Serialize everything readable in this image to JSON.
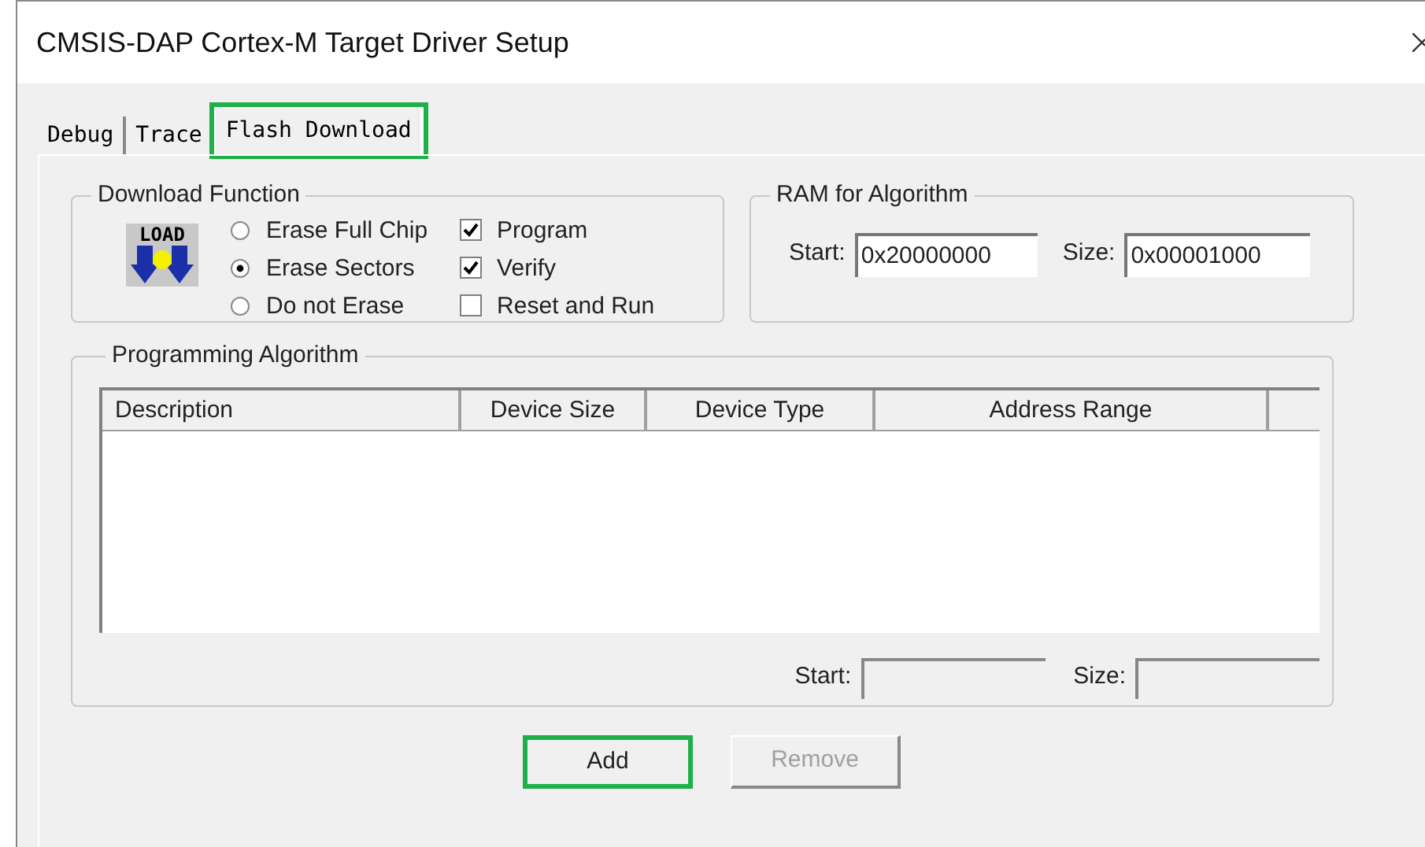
{
  "window": {
    "title": "CMSIS-DAP Cortex-M Target Driver Setup"
  },
  "tabs": [
    {
      "label": "Debug",
      "selected": false,
      "highlighted": false
    },
    {
      "label": "Trace",
      "selected": false,
      "highlighted": false
    },
    {
      "label": "Flash Download",
      "selected": true,
      "highlighted": true
    }
  ],
  "download_function": {
    "title": "Download Function",
    "icon_label": "LOAD",
    "erase_options": [
      {
        "label": "Erase Full Chip",
        "selected": false
      },
      {
        "label": "Erase Sectors",
        "selected": true
      },
      {
        "label": "Do not Erase",
        "selected": false
      }
    ],
    "checkboxes": [
      {
        "label": "Program",
        "checked": true
      },
      {
        "label": "Verify",
        "checked": true
      },
      {
        "label": "Reset and Run",
        "checked": false
      }
    ]
  },
  "ram_for_algorithm": {
    "title": "RAM for Algorithm",
    "start_label": "Start:",
    "start_value": "0x20000000",
    "size_label": "Size:",
    "size_value": "0x00001000"
  },
  "programming_algorithm": {
    "title": "Programming Algorithm",
    "table": {
      "columns": [
        "Description",
        "Device Size",
        "Device Type",
        "Address Range"
      ]
    },
    "start_label": "Start:",
    "size_label": "Size:"
  },
  "buttons": [
    {
      "label": "Add",
      "disabled": false,
      "highlighted": true
    },
    {
      "label": "Remove",
      "disabled": true,
      "highlighted": false
    }
  ]
}
